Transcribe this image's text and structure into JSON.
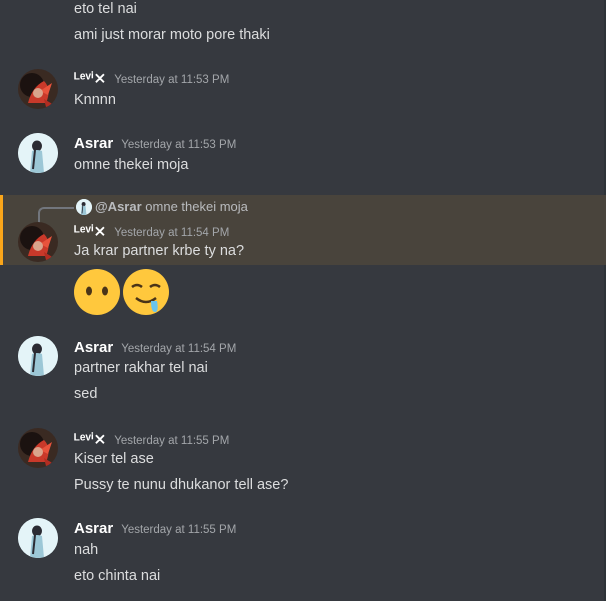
{
  "colors": {
    "background": "#36393f",
    "reply_highlight": "#49443c",
    "accent": "#faa61a",
    "username_levi": "#ffffff",
    "username_asrar": "#ffffff"
  },
  "messages": {
    "m0": {
      "line1": "eto tel nai",
      "line2": "ami just morar moto pore thaki"
    },
    "m1": {
      "username": "ᴸᵉᵛⁱ⨯",
      "timestamp": "Yesterday at 11:53 PM",
      "line1": "Knnnn"
    },
    "m2": {
      "username": "Asrar",
      "timestamp": "Yesterday at 11:53 PM",
      "line1": "omne thekei moja"
    },
    "m3": {
      "reply": {
        "username": "@Asrar",
        "text": "omne thekei moja"
      },
      "username": "ᴸᵉᵛⁱ⨯",
      "timestamp": "Yesterday at 11:54 PM",
      "line1": "Ja krar partner krbe ty na?",
      "emojis": [
        "no-mouth-face",
        "drooling-face"
      ]
    },
    "m4": {
      "username": "Asrar",
      "timestamp": "Yesterday at 11:54 PM",
      "line1": "partner rakhar tel nai",
      "line2": "sed"
    },
    "m5": {
      "username": "ᴸᵉᵛⁱ⨯",
      "timestamp": "Yesterday at 11:55 PM",
      "line1": "Kiser tel ase",
      "line2": "Pussy te nunu dhukanor tell ase?"
    },
    "m6": {
      "username": "Asrar",
      "timestamp": "Yesterday at 11:55 PM",
      "line1": "nah",
      "line2": "eto chinta nai"
    }
  }
}
